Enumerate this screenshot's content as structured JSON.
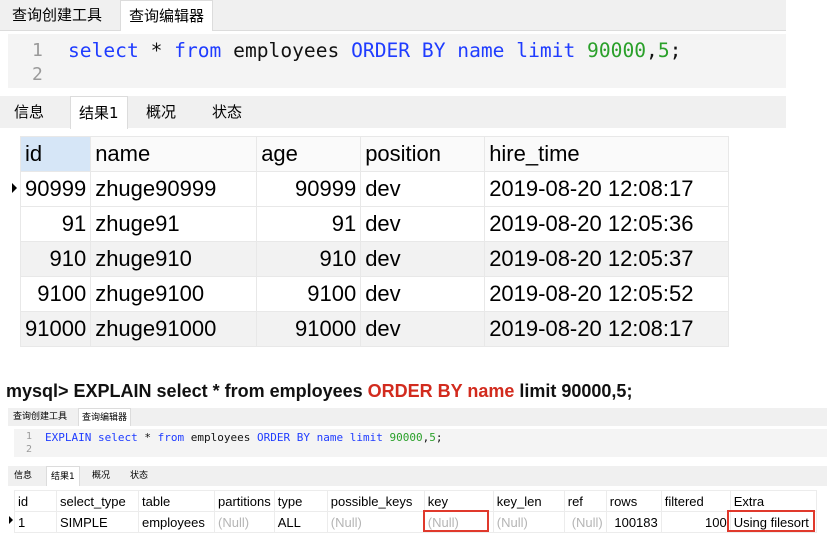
{
  "panel1": {
    "tabs": [
      "查询创建工具",
      "查询编辑器"
    ],
    "line_numbers": [
      "1",
      "2"
    ],
    "sql": {
      "select": "select",
      "star": " * ",
      "from": "from",
      "table": " employees ",
      "order_by": "ORDER BY",
      "col": " name ",
      "limit": "limit",
      "offset": " 90000",
      "comma": ",",
      "count": "5",
      "semicolon": ";"
    },
    "result_tabs": [
      "信息",
      "结果1",
      "概况",
      "状态"
    ],
    "columns": [
      "id",
      "name",
      "age",
      "position",
      "hire_time"
    ],
    "rows": [
      [
        "90999",
        "zhuge90999",
        "90999",
        "dev",
        "2019-08-20 12:08:17"
      ],
      [
        "91",
        "zhuge91",
        "91",
        "dev",
        "2019-08-20 12:05:36"
      ],
      [
        "910",
        "zhuge910",
        "910",
        "dev",
        "2019-08-20 12:05:37"
      ],
      [
        "9100",
        "zhuge9100",
        "9100",
        "dev",
        "2019-08-20 12:05:52"
      ],
      [
        "91000",
        "zhuge91000",
        "91000",
        "dev",
        "2019-08-20 12:08:17"
      ]
    ]
  },
  "caption": {
    "prefix": "mysql> EXPLAIN select * from employees ",
    "highlight": "ORDER BY name",
    "suffix": " limit 90000,5;"
  },
  "panel2": {
    "tabs": [
      "查询创建工具",
      "查询编辑器"
    ],
    "line_numbers": [
      "1",
      "2"
    ],
    "sql": {
      "explain": "EXPLAIN",
      "select": "select",
      "star": " * ",
      "from": "from",
      "table": " employees ",
      "order_by": "ORDER BY",
      "col": " name ",
      "limit": "limit",
      "offset": " 90000",
      "comma": ",",
      "count": "5",
      "semicolon": ";"
    },
    "result_tabs": [
      "信息",
      "结果1",
      "概况",
      "状态"
    ],
    "columns": [
      "id",
      "select_type",
      "table",
      "partitions",
      "type",
      "possible_keys",
      "key",
      "key_len",
      "ref",
      "rows",
      "filtered",
      "Extra"
    ],
    "row": [
      "1",
      "SIMPLE",
      "employees",
      "(Null)",
      "ALL",
      "(Null)",
      "(Null)",
      "(Null)",
      "(Null)",
      "100183",
      "100",
      "Using filesort"
    ]
  },
  "colors": {
    "keyword": "#1f3cff",
    "number": "#2aa02a",
    "highlight_red": "#d22b1e",
    "box_red": "#e0392c",
    "null_gray": "#b5b5b5"
  }
}
